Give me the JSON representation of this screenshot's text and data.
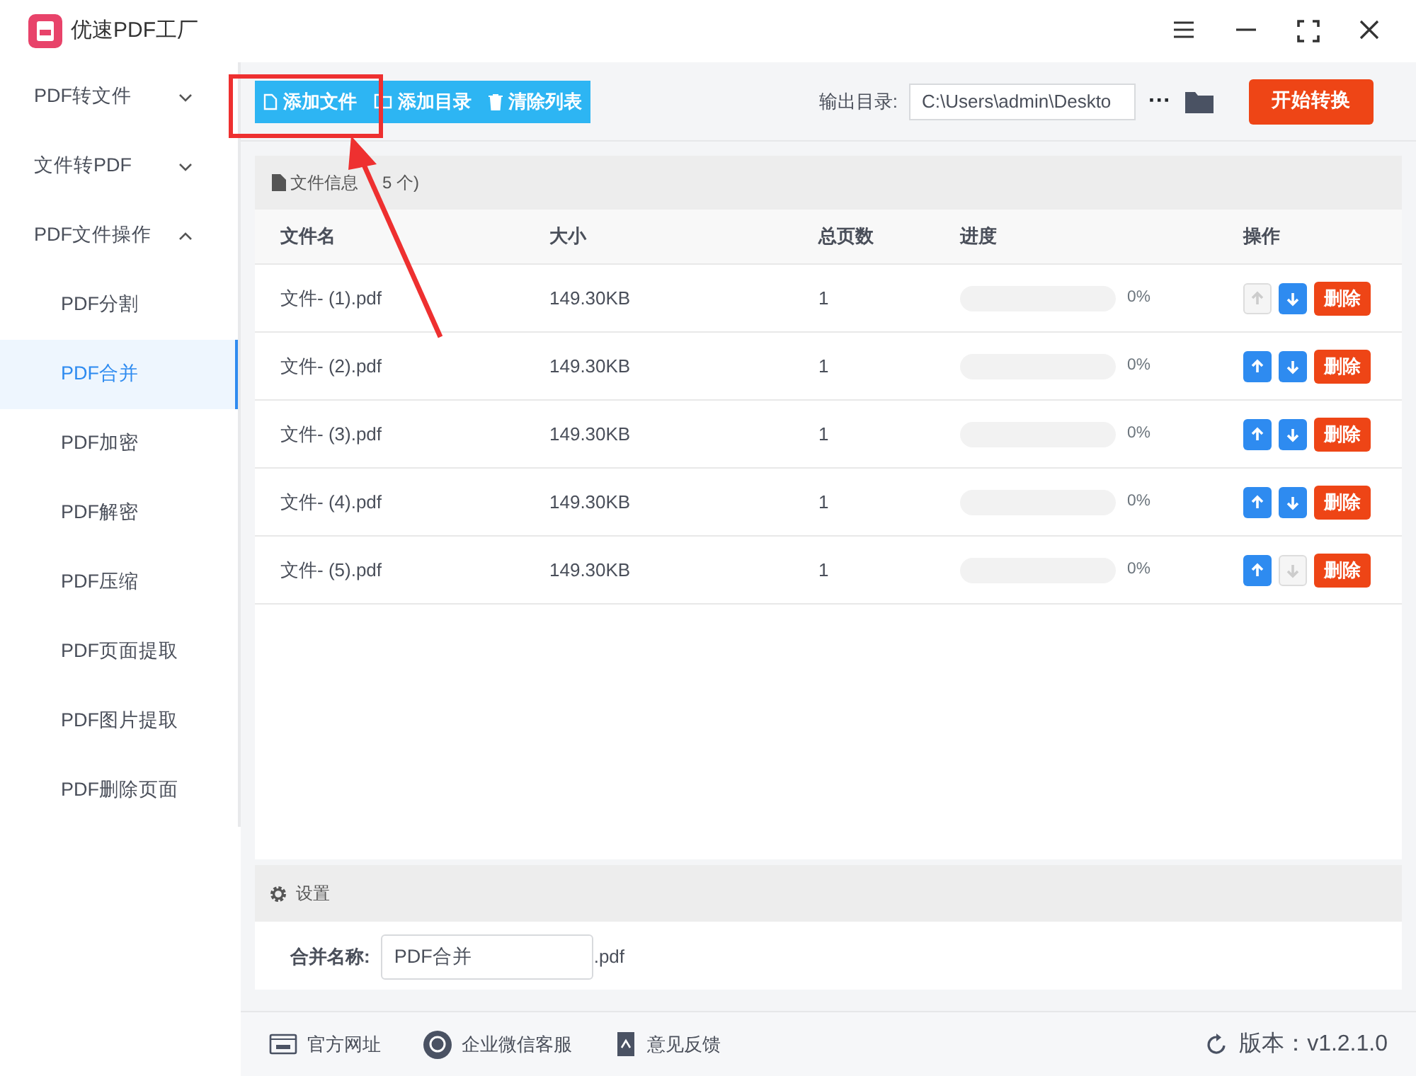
{
  "window": {
    "title": "优速PDF工厂"
  },
  "sidebar": {
    "items": [
      {
        "label": "PDF转文件",
        "expanded": false
      },
      {
        "label": "文件转PDF",
        "expanded": false
      },
      {
        "label": "PDF文件操作",
        "expanded": true,
        "children": [
          {
            "label": "PDF分割",
            "selected": false
          },
          {
            "label": "PDF合并",
            "selected": true
          },
          {
            "label": "PDF加密",
            "selected": false
          },
          {
            "label": "PDF解密",
            "selected": false
          },
          {
            "label": "PDF压缩",
            "selected": false
          },
          {
            "label": "PDF页面提取",
            "selected": false
          },
          {
            "label": "PDF图片提取",
            "selected": false
          },
          {
            "label": "PDF删除页面",
            "selected": false
          }
        ]
      }
    ]
  },
  "toolbar": {
    "buttons": [
      {
        "kind": "file",
        "label": "添加文件"
      },
      {
        "kind": "folder",
        "label": "添加目录"
      },
      {
        "kind": "trash",
        "label": "清除列表"
      }
    ],
    "output_label": "输出目录:",
    "output_path": "C:\\Users\\admin\\Deskto",
    "more": "···",
    "start_button": "开始转换"
  },
  "file_panel": {
    "title": "文件信息",
    "count": "5 个)",
    "columns": [
      "文件名",
      "大小",
      "总页数",
      "进度",
      "操作"
    ],
    "rows": [
      {
        "name": "文件- (1).pdf",
        "size": "149.30KB",
        "pages": "1",
        "level": 0,
        "reading": "0%",
        "up_disabled": true,
        "down_disabled": false,
        "delete": "删除"
      },
      {
        "name": "文件- (2).pdf",
        "size": "149.30KB",
        "pages": "1",
        "level": 0,
        "reading": "0%",
        "up_disabled": false,
        "down_disabled": false,
        "delete": "删除"
      },
      {
        "name": "文件- (3).pdf",
        "size": "149.30KB",
        "pages": "1",
        "level": 0,
        "reading": "0%",
        "up_disabled": false,
        "down_disabled": false,
        "delete": "删除"
      },
      {
        "name": "文件- (4).pdf",
        "size": "149.30KB",
        "pages": "1",
        "level": 0,
        "reading": "0%",
        "up_disabled": false,
        "down_disabled": false,
        "delete": "删除"
      },
      {
        "name": "文件- (5).pdf",
        "size": "149.30KB",
        "pages": "1",
        "level": 0,
        "reading": "0%",
        "up_disabled": false,
        "down_disabled": true,
        "delete": "删除"
      }
    ]
  },
  "settings": {
    "title": "设置",
    "name_label": "合并名称:",
    "name_value": "PDF合并",
    "suffix": ".pdf"
  },
  "footer": {
    "links": [
      {
        "kind": "web",
        "label": "官方网址"
      },
      {
        "kind": "chat",
        "label": "企业微信客服"
      },
      {
        "kind": "feedback",
        "label": "意见反馈"
      }
    ],
    "version": "版本：v1.2.1.0"
  }
}
